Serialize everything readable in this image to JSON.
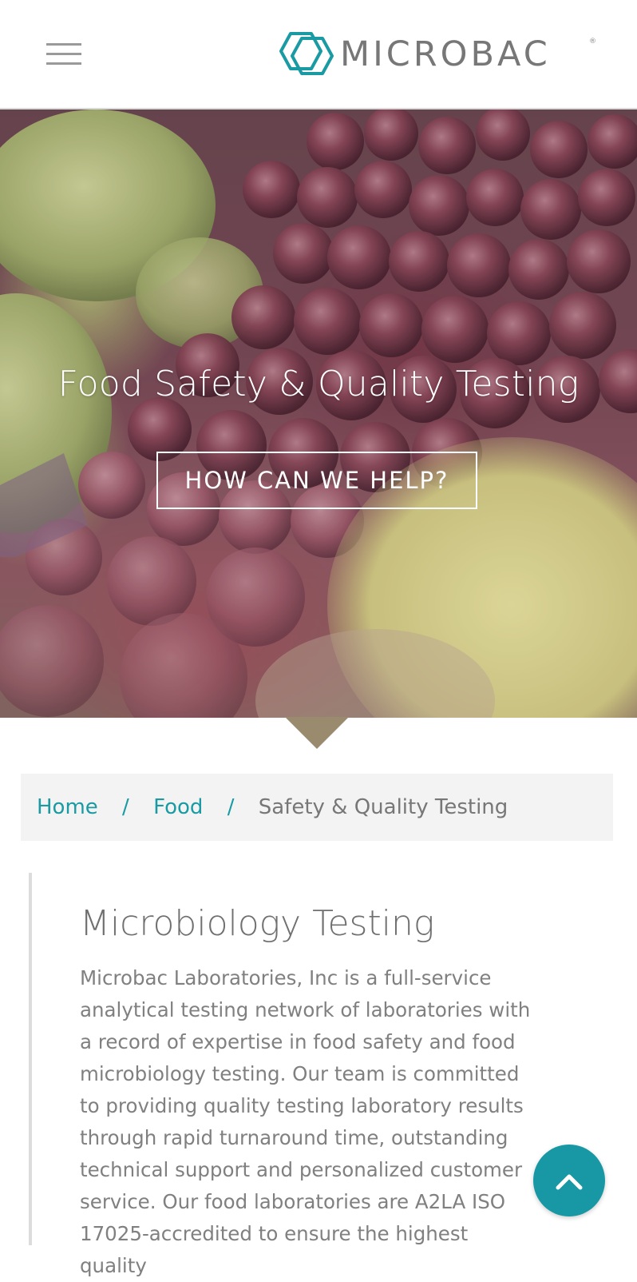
{
  "header": {
    "menu_icon": "hamburger-menu-icon",
    "logo_text": "MICROBAC",
    "logo_registered": "®",
    "logo_color": "#1a9aa3"
  },
  "hero": {
    "title": "Food Safety & Quality Testing",
    "cta_label": "HOW CAN WE HELP?"
  },
  "breadcrumb": {
    "items": [
      {
        "label": "Home"
      },
      {
        "label": "Food"
      }
    ],
    "separator": "/",
    "current": "Safety & Quality Testing"
  },
  "main": {
    "title": "Microbiology Testing",
    "body": "Microbac Laboratories, Inc is a full-service analytical testing network of laboratories with a record of expertise in food safety and food microbiology testing. Our team is committed to providing quality testing laboratory results through rapid turnaround time, outstanding technical support and personalized customer service. Our food laboratories are A2LA ISO 17025-accredited to ensure the highest quality"
  },
  "scroll_top": {
    "icon": "chevron-up-icon",
    "color": "#1798a4"
  },
  "colors": {
    "accent": "#1a9aa3",
    "text_gray": "#777777"
  }
}
